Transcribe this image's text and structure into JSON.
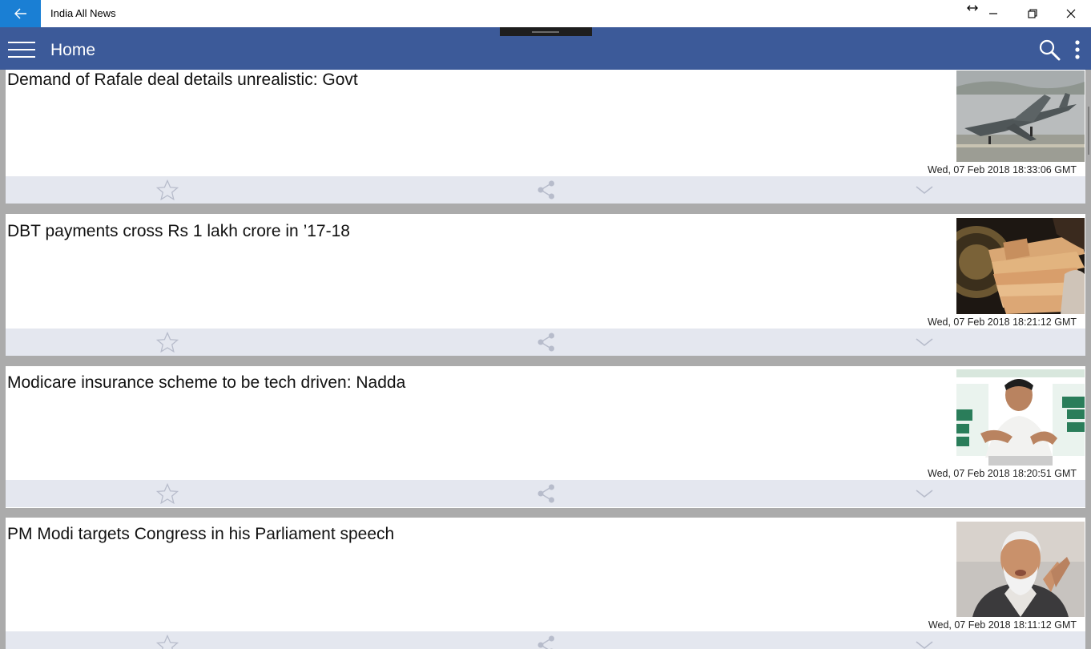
{
  "window": {
    "app_title": "India All News",
    "controls": [
      "back-icon",
      "resize-icon",
      "minimize-icon",
      "maximize-icon",
      "close-icon"
    ]
  },
  "header": {
    "title": "Home",
    "icons": [
      "hamburger-menu-icon",
      "search-icon",
      "more-vertical-icon"
    ],
    "color": "#3c5a99"
  },
  "colors": {
    "accent": "#1a7fd4",
    "header_bg": "#3c5a99",
    "action_bar_bg": "#e4e7ef",
    "feed_bg": "#ababab"
  },
  "articles": [
    {
      "headline": "Demand of Rafale deal details unrealistic: Govt",
      "date": "Wed, 07 Feb 2018 18:33:06 GMT",
      "thumb": "fighter-jet-photo"
    },
    {
      "headline": "DBT payments cross Rs 1 lakh crore in ’17-18",
      "date": "Wed, 07 Feb 2018 18:21:12 GMT",
      "thumb": "currency-notes-photo"
    },
    {
      "headline": "Modicare insurance scheme to be tech driven: Nadda",
      "date": "Wed, 07 Feb 2018 18:20:51 GMT",
      "thumb": "speaker-press-photo"
    },
    {
      "headline": "PM Modi targets Congress in his Parliament speech",
      "date": "Wed, 07 Feb 2018 18:11:12 GMT",
      "thumb": "pm-portrait-photo"
    }
  ],
  "card_actions": [
    "star-icon",
    "share-icon",
    "chevron-down-icon"
  ]
}
